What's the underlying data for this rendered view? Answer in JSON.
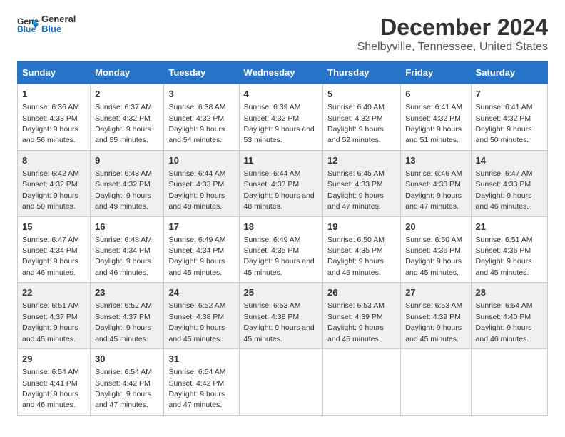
{
  "logo": {
    "line1": "General",
    "line2": "Blue"
  },
  "title": "December 2024",
  "subtitle": "Shelbyville, Tennessee, United States",
  "days_of_week": [
    "Sunday",
    "Monday",
    "Tuesday",
    "Wednesday",
    "Thursday",
    "Friday",
    "Saturday"
  ],
  "weeks": [
    [
      {
        "num": "1",
        "rise": "6:36 AM",
        "set": "4:33 PM",
        "daylight": "9 hours and 56 minutes."
      },
      {
        "num": "2",
        "rise": "6:37 AM",
        "set": "4:32 PM",
        "daylight": "9 hours and 55 minutes."
      },
      {
        "num": "3",
        "rise": "6:38 AM",
        "set": "4:32 PM",
        "daylight": "9 hours and 54 minutes."
      },
      {
        "num": "4",
        "rise": "6:39 AM",
        "set": "4:32 PM",
        "daylight": "9 hours and 53 minutes."
      },
      {
        "num": "5",
        "rise": "6:40 AM",
        "set": "4:32 PM",
        "daylight": "9 hours and 52 minutes."
      },
      {
        "num": "6",
        "rise": "6:41 AM",
        "set": "4:32 PM",
        "daylight": "9 hours and 51 minutes."
      },
      {
        "num": "7",
        "rise": "6:41 AM",
        "set": "4:32 PM",
        "daylight": "9 hours and 50 minutes."
      }
    ],
    [
      {
        "num": "8",
        "rise": "6:42 AM",
        "set": "4:32 PM",
        "daylight": "9 hours and 50 minutes."
      },
      {
        "num": "9",
        "rise": "6:43 AM",
        "set": "4:32 PM",
        "daylight": "9 hours and 49 minutes."
      },
      {
        "num": "10",
        "rise": "6:44 AM",
        "set": "4:33 PM",
        "daylight": "9 hours and 48 minutes."
      },
      {
        "num": "11",
        "rise": "6:44 AM",
        "set": "4:33 PM",
        "daylight": "9 hours and 48 minutes."
      },
      {
        "num": "12",
        "rise": "6:45 AM",
        "set": "4:33 PM",
        "daylight": "9 hours and 47 minutes."
      },
      {
        "num": "13",
        "rise": "6:46 AM",
        "set": "4:33 PM",
        "daylight": "9 hours and 47 minutes."
      },
      {
        "num": "14",
        "rise": "6:47 AM",
        "set": "4:33 PM",
        "daylight": "9 hours and 46 minutes."
      }
    ],
    [
      {
        "num": "15",
        "rise": "6:47 AM",
        "set": "4:34 PM",
        "daylight": "9 hours and 46 minutes."
      },
      {
        "num": "16",
        "rise": "6:48 AM",
        "set": "4:34 PM",
        "daylight": "9 hours and 46 minutes."
      },
      {
        "num": "17",
        "rise": "6:49 AM",
        "set": "4:34 PM",
        "daylight": "9 hours and 45 minutes."
      },
      {
        "num": "18",
        "rise": "6:49 AM",
        "set": "4:35 PM",
        "daylight": "9 hours and 45 minutes."
      },
      {
        "num": "19",
        "rise": "6:50 AM",
        "set": "4:35 PM",
        "daylight": "9 hours and 45 minutes."
      },
      {
        "num": "20",
        "rise": "6:50 AM",
        "set": "4:36 PM",
        "daylight": "9 hours and 45 minutes."
      },
      {
        "num": "21",
        "rise": "6:51 AM",
        "set": "4:36 PM",
        "daylight": "9 hours and 45 minutes."
      }
    ],
    [
      {
        "num": "22",
        "rise": "6:51 AM",
        "set": "4:37 PM",
        "daylight": "9 hours and 45 minutes."
      },
      {
        "num": "23",
        "rise": "6:52 AM",
        "set": "4:37 PM",
        "daylight": "9 hours and 45 minutes."
      },
      {
        "num": "24",
        "rise": "6:52 AM",
        "set": "4:38 PM",
        "daylight": "9 hours and 45 minutes."
      },
      {
        "num": "25",
        "rise": "6:53 AM",
        "set": "4:38 PM",
        "daylight": "9 hours and 45 minutes."
      },
      {
        "num": "26",
        "rise": "6:53 AM",
        "set": "4:39 PM",
        "daylight": "9 hours and 45 minutes."
      },
      {
        "num": "27",
        "rise": "6:53 AM",
        "set": "4:39 PM",
        "daylight": "9 hours and 45 minutes."
      },
      {
        "num": "28",
        "rise": "6:54 AM",
        "set": "4:40 PM",
        "daylight": "9 hours and 46 minutes."
      }
    ],
    [
      {
        "num": "29",
        "rise": "6:54 AM",
        "set": "4:41 PM",
        "daylight": "9 hours and 46 minutes."
      },
      {
        "num": "30",
        "rise": "6:54 AM",
        "set": "4:42 PM",
        "daylight": "9 hours and 47 minutes."
      },
      {
        "num": "31",
        "rise": "6:54 AM",
        "set": "4:42 PM",
        "daylight": "9 hours and 47 minutes."
      },
      null,
      null,
      null,
      null
    ]
  ],
  "labels": {
    "sunrise": "Sunrise:",
    "sunset": "Sunset:",
    "daylight": "Daylight:"
  }
}
